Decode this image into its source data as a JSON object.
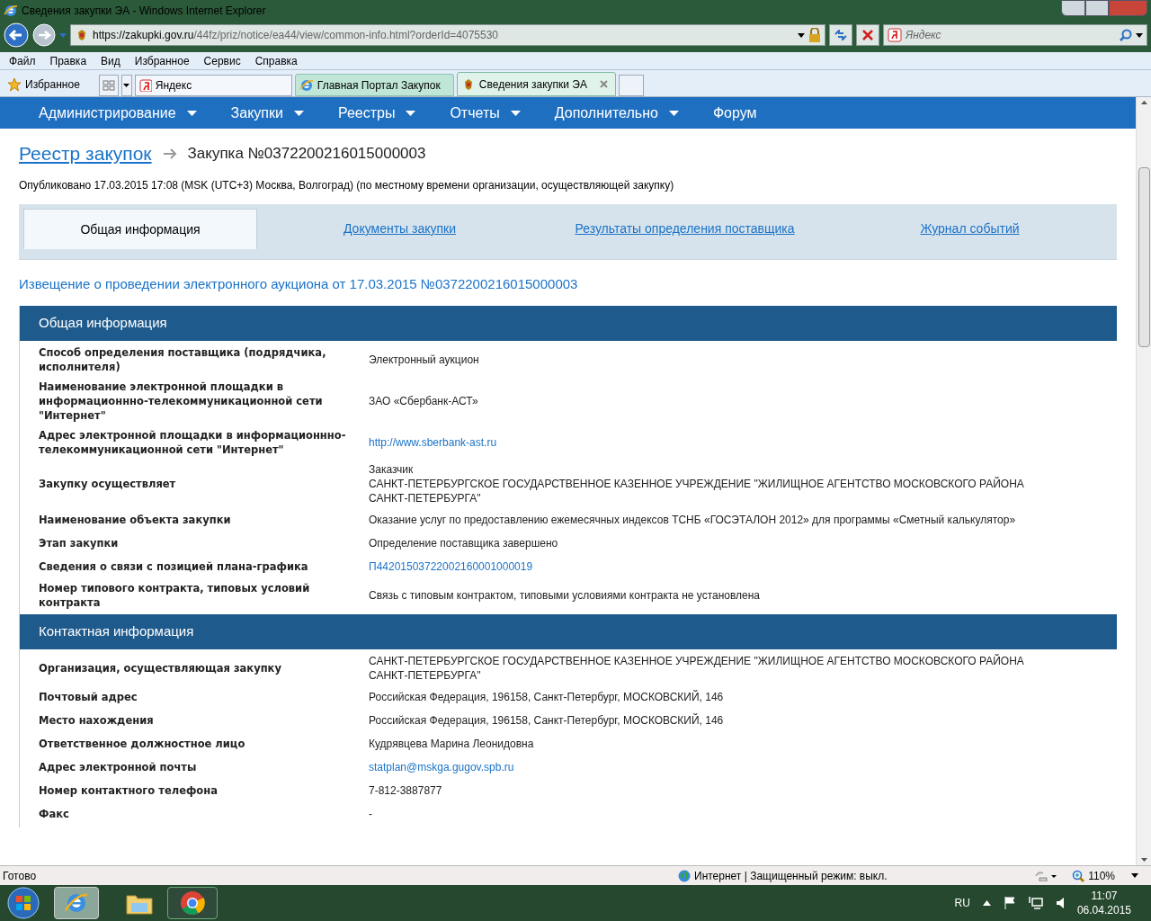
{
  "window": {
    "title": "Сведения закупки ЭА - Windows Internet Explorer"
  },
  "address_bar": {
    "url_host": "https://zakupki.gov.ru",
    "url_path": "/44fz/priz/notice/ea44/view/common-info.html?orderId=4075530"
  },
  "search": {
    "placeholder": "Яндекс"
  },
  "menu_bar": [
    "Файл",
    "Правка",
    "Вид",
    "Избранное",
    "Сервис",
    "Справка"
  ],
  "favorites_bar": {
    "favorites_label": "Избранное",
    "links": [
      {
        "label": "Яндекс"
      }
    ]
  },
  "browser_tabs": [
    {
      "label": "Главная Портал Закупок",
      "selected": false
    },
    {
      "label": "Сведения закупки ЭА",
      "selected": true
    }
  ],
  "site_nav": [
    {
      "label": "Администрирование",
      "dropdown": true
    },
    {
      "label": "Закупки",
      "dropdown": true
    },
    {
      "label": "Реестры",
      "dropdown": true
    },
    {
      "label": "Отчеты",
      "dropdown": true
    },
    {
      "label": "Дополнительно",
      "dropdown": true
    },
    {
      "label": "Форум",
      "dropdown": false
    }
  ],
  "breadcrumb": {
    "link": "Реестр закупок",
    "current": "Закупка №0372200216015000003"
  },
  "published": "Опубликовано 17.03.2015 17:08 (MSK (UTC+3) Москва, Волгоград) (по местному времени организации, осуществляющей закупку)",
  "page_tabs": [
    {
      "label": "Общая информация",
      "selected": true
    },
    {
      "label": "Документы закупки",
      "selected": false
    },
    {
      "label": "Результаты определения поставщика",
      "selected": false
    },
    {
      "label": "Журнал событий",
      "selected": false
    }
  ],
  "notice_title": "Извещение о проведении электронного аукциона от 17.03.2015 №0372200216015000003",
  "sections": [
    {
      "title": "Общая информация",
      "rows": [
        {
          "label": "Способ определения поставщика (подрядчика, исполнителя)",
          "kind": "text",
          "value": [
            "Электронный аукцион"
          ]
        },
        {
          "label": "Наименование электронной площадки в информационнно-телекоммуникационной сети \"Интернет\"",
          "kind": "text",
          "value": [
            "ЗАО «Сбербанк-АСТ»"
          ]
        },
        {
          "label": "Адрес электронной площадки в информационнно-телекоммуникационной сети \"Интернет\"",
          "kind": "link",
          "value": [
            "http://www.sberbank-ast.ru"
          ]
        },
        {
          "label": "Закупку осуществляет",
          "kind": "text",
          "value": [
            "Заказчик",
            "САНКТ-ПЕТЕРБУРГСКОЕ ГОСУДАРСТВЕННОЕ КАЗЕННОЕ УЧРЕЖДЕНИЕ \"ЖИЛИЩНОЕ АГЕНТСТВО МОСКОВСКОГО РАЙОНА САНКТ-ПЕТЕРБУРГА\""
          ]
        },
        {
          "label": "Наименование объекта закупки",
          "kind": "text",
          "value": [
            "Оказание услуг по предоставлению ежемесячных индексов ТСНБ «ГОСЭТАЛОН 2012» для программы «Сметный калькулятор»"
          ]
        },
        {
          "label": "Этап закупки",
          "kind": "text",
          "value": [
            "Определение поставщика завершено"
          ]
        },
        {
          "label": "Сведения о связи с позицией плана-графика",
          "kind": "link",
          "value": [
            "П44201503722002160001000019"
          ]
        },
        {
          "label": "Номер типового контракта, типовых условий контракта",
          "kind": "text",
          "value": [
            "Связь с типовым контрактом, типовыми условиями контракта не установлена"
          ]
        }
      ]
    },
    {
      "title": "Контактная информация",
      "rows": [
        {
          "label": "Организация, осуществляющая закупку",
          "kind": "text",
          "value": [
            "САНКТ-ПЕТЕРБУРГСКОЕ ГОСУДАРСТВЕННОЕ КАЗЕННОЕ УЧРЕЖДЕНИЕ \"ЖИЛИЩНОЕ АГЕНТСТВО МОСКОВСКОГО РАЙОНА САНКТ-ПЕТЕРБУРГА\""
          ]
        },
        {
          "label": "Почтовый адрес",
          "kind": "text",
          "value": [
            "Российская Федерация, 196158, Санкт-Петербург, МОСКОВСКИЙ, 146"
          ]
        },
        {
          "label": "Место нахождения",
          "kind": "text",
          "value": [
            "Российская Федерация, 196158, Санкт-Петербург, МОСКОВСКИЙ, 146"
          ]
        },
        {
          "label": "Ответственное должностное лицо",
          "kind": "text",
          "value": [
            "Кудрявцева Марина Леонидовна"
          ]
        },
        {
          "label": "Адрес электронной почты",
          "kind": "link",
          "value": [
            "statplan@mskga.gugov.spb.ru"
          ]
        },
        {
          "label": "Номер контактного телефона",
          "kind": "text",
          "value": [
            "7-812-3887877"
          ]
        },
        {
          "label": "Факс",
          "kind": "text",
          "value": [
            "-"
          ]
        }
      ]
    }
  ],
  "status_bar": {
    "text": "Готово",
    "zone": "Интернет | Защищенный режим: выкл.",
    "zoom": "110%"
  },
  "taskbar": {
    "language": "RU",
    "time": "11:07",
    "date": "06.04.2015"
  }
}
